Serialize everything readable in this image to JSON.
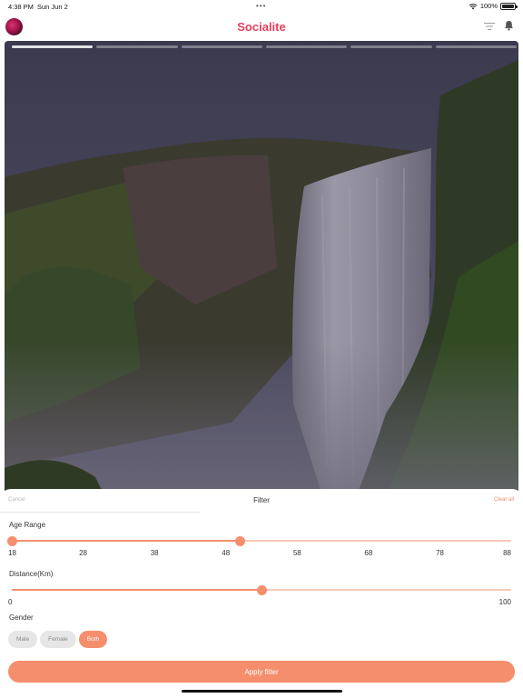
{
  "status_bar": {
    "time": "4:38 PM",
    "date": "Sun Jun 2",
    "dots": "•••",
    "battery": "100%"
  },
  "nav": {
    "title": "Socialite",
    "title_color": "#e8405a",
    "avatar_icon": "avatar",
    "filter_icon": "filter-icon",
    "bell_icon": "bell-icon"
  },
  "story": {
    "segments": 6,
    "active_segment": 1
  },
  "filter": {
    "cancel_label": "Cancel",
    "title": "Filter",
    "clear_label": "Clear all",
    "age": {
      "label": "Age Range",
      "min": 18,
      "max": 88,
      "value": 50,
      "ticks": [
        "18",
        "28",
        "38",
        "48",
        "58",
        "68",
        "78",
        "88"
      ]
    },
    "distance": {
      "label": "Distance(Km)",
      "min": 0,
      "max": 100,
      "value": 50,
      "min_label": "0",
      "max_label": "100"
    },
    "gender": {
      "label": "Gender",
      "options": [
        "Male",
        "Female",
        "Both"
      ],
      "selected": "Both"
    },
    "apply_label": "Apply filter",
    "accent_color": "#f58e6d"
  }
}
